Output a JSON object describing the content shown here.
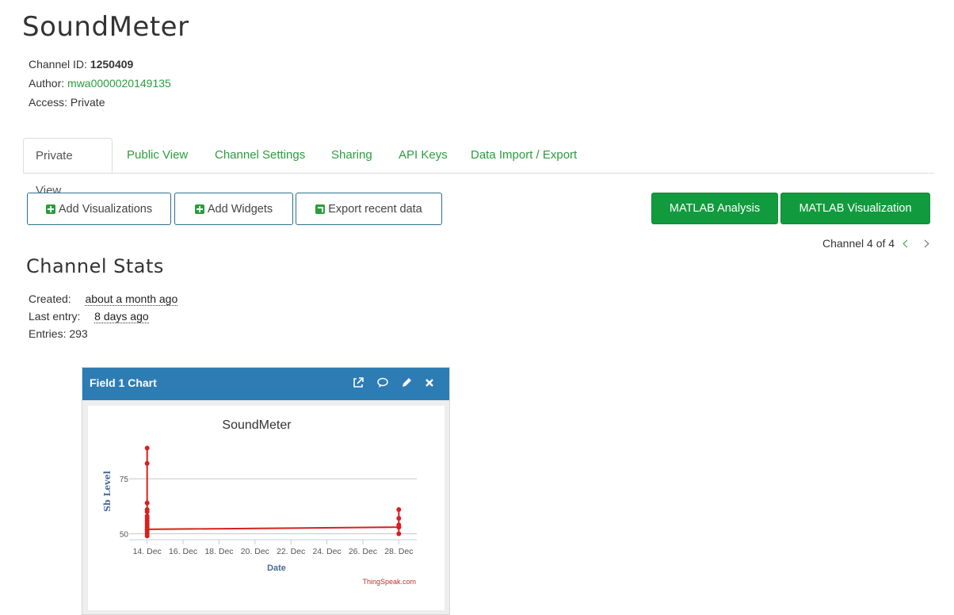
{
  "channel": {
    "title": "SoundMeter",
    "id_label": "Channel ID:",
    "id": "1250409",
    "author_label": "Author:",
    "author": "mwa0000020149135",
    "access_label": "Access:",
    "access": "Private"
  },
  "tabs": [
    {
      "label": "Private View",
      "active": true
    },
    {
      "label": "Public View"
    },
    {
      "label": "Channel Settings"
    },
    {
      "label": "Sharing"
    },
    {
      "label": "API Keys"
    },
    {
      "label": "Data Import / Export"
    }
  ],
  "actions": {
    "add_visualizations": "Add Visualizations",
    "add_widgets": "Add Widgets",
    "export_recent": "Export recent data",
    "matlab_analysis": "MATLAB Analysis",
    "matlab_visualization": "MATLAB Visualization"
  },
  "pager": {
    "text": "Channel 4 of 4"
  },
  "stats": {
    "heading": "Channel Stats",
    "created_label": "Created:",
    "created": "about a month ago",
    "last_entry_label": "Last entry:",
    "last_entry": "8 days ago",
    "entries_label": "Entries:",
    "entries": "293"
  },
  "panel": {
    "title": "Field 1 Chart",
    "icons": [
      "external-link-icon",
      "comment-icon",
      "pencil-icon",
      "close-icon"
    ]
  },
  "chart_data": {
    "type": "line",
    "title": "SoundMeter",
    "xlabel": "Date",
    "ylabel": "Sb Level",
    "credit": "ThingSpeak.com",
    "color": "#d62020",
    "x_ticks": [
      "14. Dec",
      "16. Dec",
      "18. Dec",
      "20. Dec",
      "22. Dec",
      "24. Dec",
      "26. Dec",
      "28. Dec"
    ],
    "y_ticks": [
      50,
      75
    ],
    "ylim": [
      48,
      92
    ],
    "xlim_days": [
      "13. Dec",
      "29. Dec"
    ],
    "grid": true,
    "series": [
      {
        "x": [
          "14. Dec",
          "14. Dec",
          "14. Dec",
          "14. Dec",
          "14. Dec",
          "14. Dec",
          "14. Dec",
          "14. Dec",
          "14. Dec",
          "14. Dec",
          "14. Dec",
          "14. Dec",
          "14. Dec",
          "14. Dec",
          "14. Dec",
          "14. Dec",
          "28. Dec",
          "28. Dec",
          "28. Dec",
          "28. Dec",
          "28. Dec",
          "28. Dec"
        ],
        "y": [
          49,
          89,
          82,
          64,
          61,
          60,
          58,
          57,
          56,
          55,
          54,
          53,
          52,
          51,
          50,
          52,
          53,
          61,
          57,
          54,
          53,
          50
        ]
      }
    ]
  }
}
